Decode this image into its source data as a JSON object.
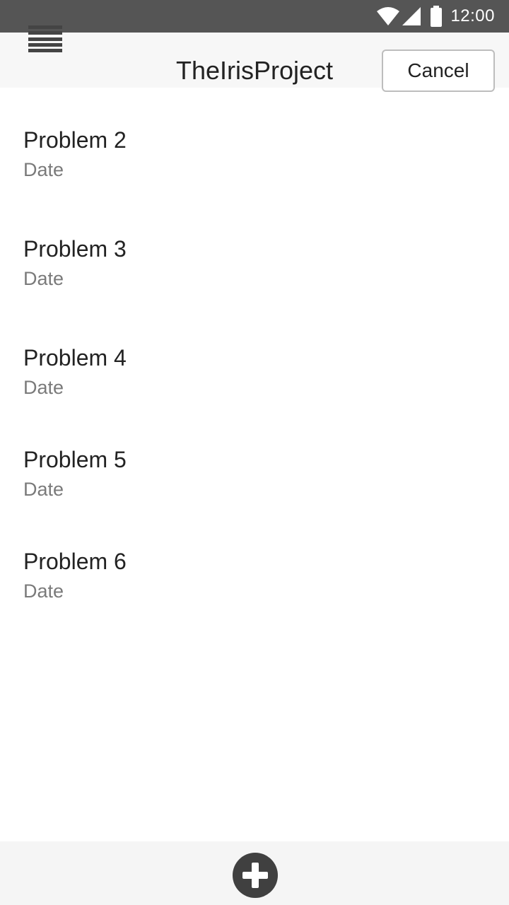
{
  "status_bar": {
    "time": "12:00",
    "icons": [
      "wifi-icon",
      "signal-icon",
      "battery-icon"
    ],
    "background_color": "#555555"
  },
  "app_bar": {
    "title": "TheIrisProject",
    "cancel_label": "Cancel",
    "menu_icon": "hamburger-menu-icon"
  },
  "problems": [
    {
      "title": "Problem 2",
      "date": "Date"
    },
    {
      "title": "Problem 3",
      "date": "Date"
    },
    {
      "title": "Problem 4",
      "date": "Date"
    },
    {
      "title": "Problem 5",
      "date": "Date"
    },
    {
      "title": "Problem 6",
      "date": "Date"
    }
  ],
  "bottom_bar": {
    "add_icon": "plus-circle-icon"
  }
}
